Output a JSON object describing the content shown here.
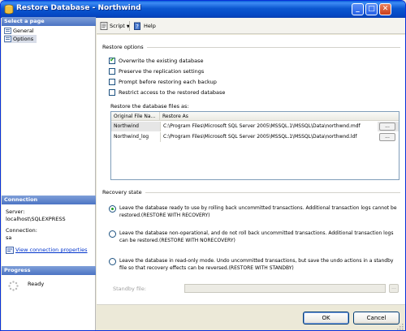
{
  "window": {
    "title": "Restore Database - Northwind"
  },
  "left_pane": {
    "select_page_header": "Select a page",
    "pages": [
      {
        "label": "General",
        "selected": false
      },
      {
        "label": "Options",
        "selected": true
      }
    ],
    "connection_header": "Connection",
    "server_label": "Server:",
    "server_value": "localhost\\SQLEXPRESS",
    "connection_label": "Connection:",
    "connection_value": "sa",
    "view_connection_link": "View connection properties",
    "progress_header": "Progress",
    "progress_status": "Ready"
  },
  "toolbar": {
    "script_label": "Script",
    "help_label": "Help"
  },
  "restore_options": {
    "header": "Restore options",
    "checkboxes": [
      {
        "label": "Overwrite the existing database",
        "checked": true
      },
      {
        "label": "Preserve the replication settings",
        "checked": false
      },
      {
        "label": "Prompt before restoring each backup",
        "checked": false
      },
      {
        "label": "Restrict access to the restored database",
        "checked": false
      }
    ],
    "files_label": "Restore the database files as:",
    "columns": [
      "Original File Na...",
      "Restore As"
    ],
    "rows": [
      {
        "original": "Northwind",
        "restore_as": "C:\\Program Files\\Microsoft SQL Server 2005\\MSSQL.1\\MSSQL\\Data\\northwnd.mdf",
        "button": "...",
        "selected": true
      },
      {
        "original": "Northwind_log",
        "restore_as": "C:\\Program Files\\Microsoft SQL Server 2005\\MSSQL.1\\MSSQL\\Data\\northwnd.ldf",
        "button": "...",
        "selected": false
      }
    ]
  },
  "recovery_state": {
    "header": "Recovery state",
    "options": [
      {
        "label": "Leave the database ready to use by rolling back uncommitted transactions. Additional transaction logs cannot be restored.(RESTORE WITH RECOVERY)",
        "selected": true
      },
      {
        "label": "Leave the database non-operational, and do not roll back uncommitted transactions. Additional transaction logs can be restored.(RESTORE WITH NORECOVERY)",
        "selected": false
      },
      {
        "label": "Leave the database in read-only mode. Undo uncommitted transactions, but save the undo actions in a standby file so that recovery effects can be reversed.(RESTORE WITH STANDBY)",
        "selected": false
      }
    ],
    "standby_label": "Standby file:",
    "standby_value": "",
    "standby_button": "..."
  },
  "footer": {
    "ok_label": "OK",
    "cancel_label": "Cancel"
  }
}
